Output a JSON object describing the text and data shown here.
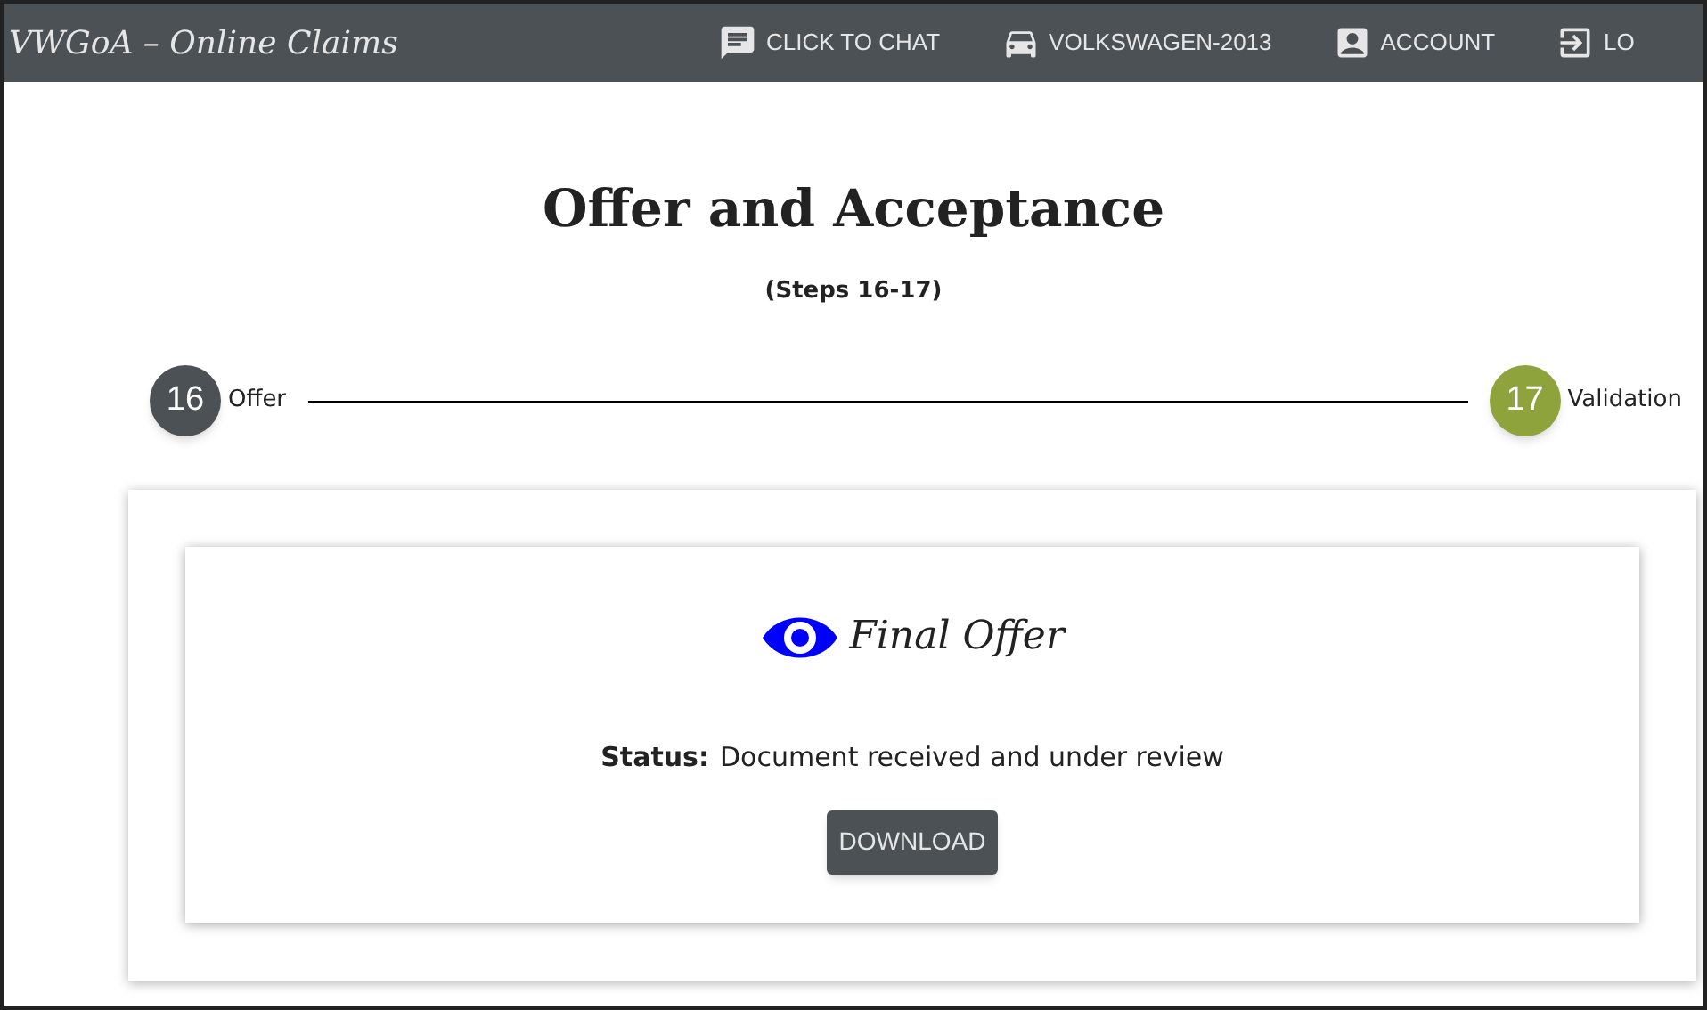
{
  "header": {
    "title": "VWGoA – Online Claims",
    "nav": [
      {
        "kind": "chat",
        "label": "CLICK TO CHAT"
      },
      {
        "kind": "car",
        "label": "VOLKSWAGEN-2013"
      },
      {
        "kind": "account",
        "label": "ACCOUNT"
      },
      {
        "kind": "logout",
        "label": "LO"
      }
    ]
  },
  "page": {
    "title": "Offer and Acceptance",
    "subtitle": "(Steps 16-17)"
  },
  "steps": [
    {
      "number": "16",
      "label": "Offer",
      "color": "#4b5154"
    },
    {
      "number": "17",
      "label": "Validation",
      "color": "#8fa33d"
    }
  ],
  "card": {
    "title": "Final Offer",
    "status_label": "Status:",
    "status_value": "Document received and under review",
    "button": "DOWNLOAD"
  }
}
